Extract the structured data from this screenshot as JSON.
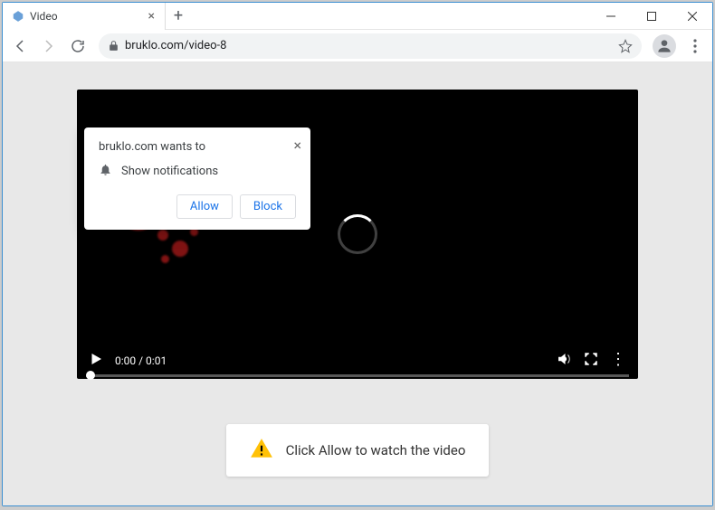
{
  "window": {
    "tab_title": "Video",
    "url": "bruklo.com/video-8"
  },
  "permission": {
    "title": "bruklo.com wants to",
    "body": "Show notifications",
    "allow": "Allow",
    "block": "Block"
  },
  "video": {
    "time": "0:00 / 0:01"
  },
  "banner": {
    "text": "Click Allow to watch the video"
  }
}
